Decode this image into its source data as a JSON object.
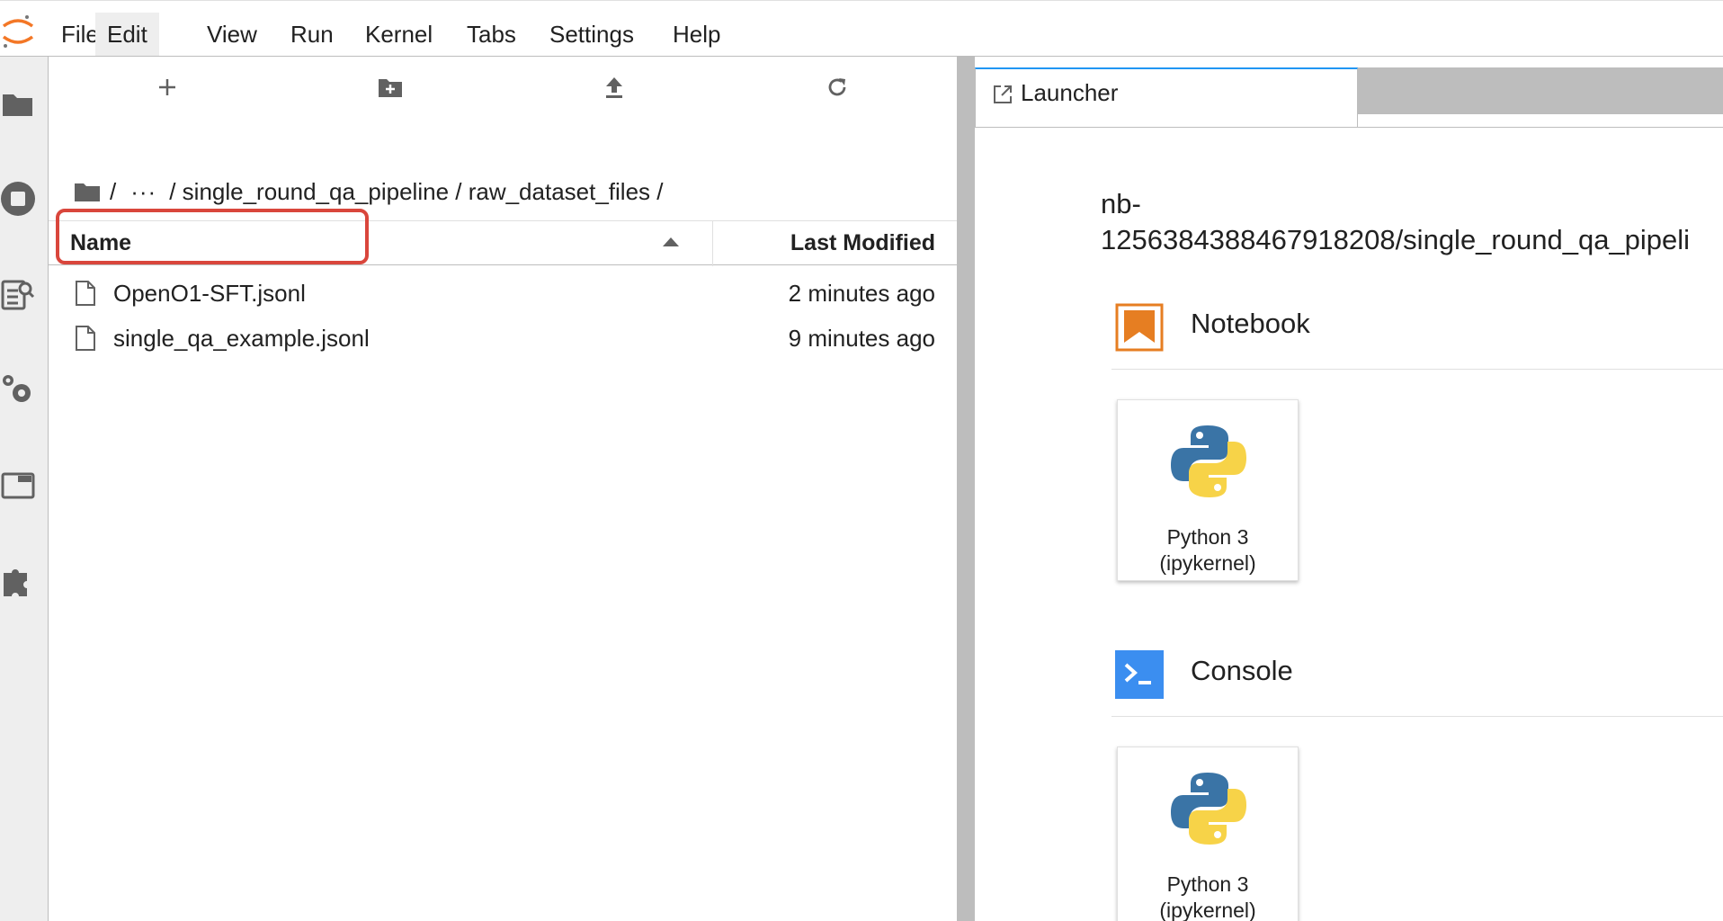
{
  "menu": {
    "items": [
      "File",
      "Edit",
      "View",
      "Run",
      "Kernel",
      "Tabs",
      "Settings",
      "Help"
    ],
    "active": "Edit"
  },
  "activity_icons": [
    "folder-icon",
    "running-icon",
    "table-of-contents-icon",
    "property-inspector-icon",
    "tabs-icon",
    "extension-icon"
  ],
  "file_browser": {
    "toolbar_icons": [
      "new-launcher-icon",
      "new-folder-icon",
      "upload-icon",
      "refresh-icon"
    ],
    "breadcrumb": {
      "root": "/",
      "ellipsis": "···",
      "path": "/ single_round_qa_pipeline / raw_dataset_files /"
    },
    "columns": {
      "name": "Name",
      "last_modified": "Last Modified"
    },
    "files": [
      {
        "name": "OpenO1-SFT.jsonl",
        "modified": "2 minutes ago",
        "highlighted": true
      },
      {
        "name": "single_qa_example.jsonl",
        "modified": "9 minutes ago",
        "highlighted": false
      }
    ],
    "highlight_color": "#d9463c"
  },
  "tabs": [
    {
      "label": "Launcher",
      "active": true
    }
  ],
  "launcher": {
    "cwd_line1": "nb-",
    "cwd_line2": "1256384388467918208/single_round_qa_pipeli",
    "sections": [
      {
        "title": "Notebook",
        "icon": "notebook-icon",
        "card": {
          "label_line1": "Python 3",
          "label_line2": "(ipykernel)",
          "icon": "python-logo-icon"
        }
      },
      {
        "title": "Console",
        "icon": "console-icon",
        "card": {
          "label_line1": "Python 3",
          "label_line2": "(ipykernel)",
          "icon": "python-logo-icon"
        }
      }
    ]
  },
  "colors": {
    "accent": "#2196f3",
    "notebook_orange": "#e67e22",
    "console_blue": "#3b8ef0"
  }
}
